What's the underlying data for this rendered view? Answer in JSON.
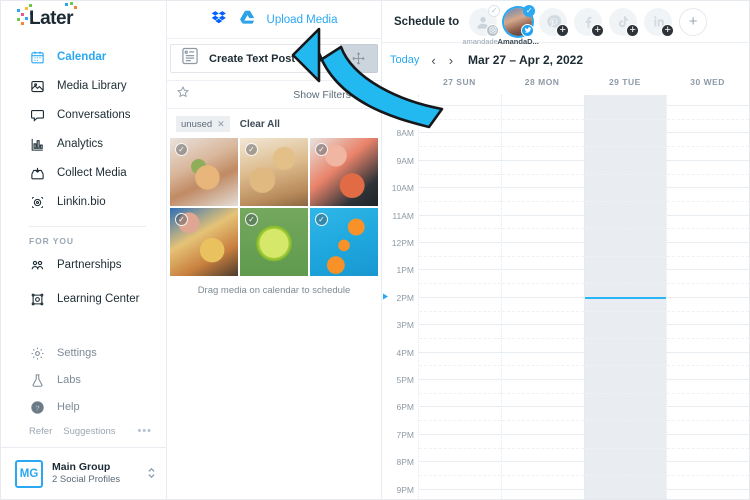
{
  "brand": {
    "name": "Later",
    "accent": "#2aa8f2",
    "logo_pixel_colors": [
      "#f2c230",
      "#6fc44c",
      "#2aa8f2",
      "#e8598b",
      "#8c5fd4",
      "#f2863b"
    ]
  },
  "sidebar": {
    "nav": [
      {
        "label": "Calendar",
        "icon": "calendar-icon",
        "active": true
      },
      {
        "label": "Media Library",
        "icon": "image-icon",
        "active": false
      },
      {
        "label": "Conversations",
        "icon": "chat-icon",
        "active": false
      },
      {
        "label": "Analytics",
        "icon": "bar-chart-icon",
        "active": false
      },
      {
        "label": "Collect Media",
        "icon": "inbox-download-icon",
        "active": false
      },
      {
        "label": "Linkin.bio",
        "icon": "linkinbio-icon",
        "active": false
      }
    ],
    "section_title": "FOR YOU",
    "for_you": [
      {
        "label": "Partnerships",
        "icon": "people-icon"
      },
      {
        "label": "Learning Center",
        "icon": "learning-icon"
      }
    ],
    "utility": [
      {
        "label": "Settings",
        "icon": "gear-icon"
      },
      {
        "label": "Labs",
        "icon": "flask-icon"
      },
      {
        "label": "Help",
        "icon": "help-circle-icon"
      }
    ],
    "mini": {
      "refer": "Refer",
      "suggestions": "Suggestions",
      "more": "•••"
    },
    "footer": {
      "initials": "MG",
      "group_name": "Main Group",
      "subtitle": "2 Social Profiles"
    }
  },
  "media_panel": {
    "upload_link": "Upload Media",
    "sources": [
      {
        "name": "dropbox-icon"
      },
      {
        "name": "google-drive-icon"
      }
    ],
    "create_text_post": "Create Text Post",
    "show_filters": "Show Filters",
    "chips": [
      {
        "label": "unused"
      }
    ],
    "clear_all": "Clear All",
    "drag_hint": "Drag media on calendar to schedule",
    "media": [
      {
        "alt": "burger-sandwich-photo",
        "checked": false,
        "cls": "im1"
      },
      {
        "alt": "pies-pastry-photo",
        "checked": true,
        "cls": "im2"
      },
      {
        "alt": "crab-legs-photo",
        "checked": true,
        "cls": "im3"
      },
      {
        "alt": "loaded-fries-photo",
        "checked": false,
        "cls": "im4"
      },
      {
        "alt": "lime-slice-photo",
        "checked": true,
        "cls": "im5"
      },
      {
        "alt": "oranges-blue-photo",
        "checked": true,
        "cls": "im6"
      }
    ]
  },
  "calendar": {
    "schedule_to_label": "Schedule to",
    "profiles": [
      {
        "network": "instagram",
        "name": "amandade...",
        "selected": false,
        "badge": "ig",
        "tick": false
      },
      {
        "network": "twitter",
        "name": "AmandaD...",
        "selected": true,
        "badge": "tw",
        "tick": true
      },
      {
        "network": "pinterest",
        "name": "",
        "selected": false,
        "badge": "plus",
        "tick": false
      },
      {
        "network": "facebook",
        "name": "",
        "selected": false,
        "badge": "plus",
        "tick": false
      },
      {
        "network": "tiktok",
        "name": "",
        "selected": false,
        "badge": "plus",
        "tick": false
      },
      {
        "network": "linkedin",
        "name": "",
        "selected": false,
        "badge": "plus",
        "tick": false
      }
    ],
    "add_profile_label": "+",
    "today_label": "Today",
    "prev_label": "‹",
    "next_label": "›",
    "date_range": "Mar 27 – Apr 2, 2022",
    "days": [
      {
        "label": "27 SUN",
        "today": false
      },
      {
        "label": "28 MON",
        "today": false
      },
      {
        "label": "29 TUE",
        "today": true
      },
      {
        "label": "30 WED",
        "today": false
      }
    ],
    "times": [
      "7AM",
      "8AM",
      "9AM",
      "10AM",
      "11AM",
      "12PM",
      "1PM",
      "2PM",
      "3PM",
      "4PM",
      "5PM",
      "6PM",
      "7PM",
      "8PM",
      "9PM"
    ],
    "current_time_slot": "2PM",
    "current_time_color": "#29b6f6"
  },
  "annotation": {
    "type": "curved-arrow",
    "color": "#22b9f0",
    "points_to": "create-text-post-button"
  }
}
